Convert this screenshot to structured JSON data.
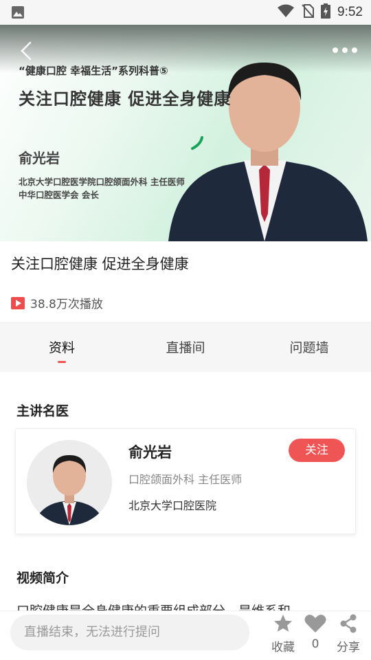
{
  "status_bar": {
    "time": "9:52"
  },
  "video": {
    "series": "“健康口腔  幸福生活”系列科普⑤",
    "title": "关注口腔健康  促进全身健康",
    "speaker_name": "俞光岩",
    "speaker_affiliation_1": "北京大学口腔医学院口腔颌面外科 主任医师",
    "speaker_affiliation_2": "中华口腔医学会 会长"
  },
  "info": {
    "title": "关注口腔健康 促进全身健康",
    "play_count": "38.8万次播放"
  },
  "tabs": [
    {
      "label": "资料",
      "active": true
    },
    {
      "label": "直播间",
      "active": false
    },
    {
      "label": "问题墙",
      "active": false
    }
  ],
  "doctor_section": {
    "title": "主讲名医",
    "name": "俞光岩",
    "department": "口腔颌面外科  主任医师",
    "hospital": "北京大学口腔医院",
    "follow_label": "关注"
  },
  "intro_section": {
    "title": "视频简介",
    "text": "口腔健康是全身健康的重要组成部分，是维系和"
  },
  "bottom_bar": {
    "input_placeholder": "直播结束，无法进行提问",
    "favorite_label": "收藏",
    "like_count": "0",
    "share_label": "分享"
  },
  "colors": {
    "accent": "#f05555",
    "play_icon": "#ee4d4d"
  }
}
